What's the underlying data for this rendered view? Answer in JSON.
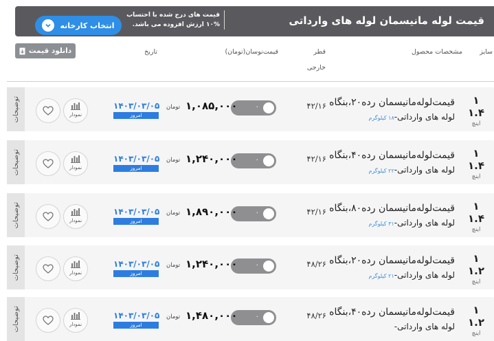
{
  "header": {
    "title": "قیمت لوله مانیسمان لوله های وارداتی",
    "note_line1": "قیمت های درج شده با احتساب",
    "note_line2": "۱۰% ارزش افزوده می باشد.",
    "factory_button": "انتخاب کارخانه"
  },
  "download_button": "دانلود قیمت",
  "columns": {
    "size": "سایز",
    "specs": "مشخصات محصول",
    "outer_dia_1": "قطر",
    "outer_dia_2": "خارجی",
    "price_change": "قیمت‌نوسان(تومان)",
    "date": "تاریخ"
  },
  "rows": [
    {
      "size": "۱ ۱.۴",
      "unit": "اینچ",
      "name": "قیمت‌لوله‌مانیسمان رده۲۰،بنگاه",
      "sub": "لوله های وارداتی-",
      "weight": "۱۸ کیلوگرم",
      "dia": "۴۲/۱۶",
      "toggle": "۰",
      "price": "۱,۰۸۵,۰۰۰",
      "toman": "تومان",
      "date": "۱۴۰۳/۰۳/۰۵",
      "today": "امروز",
      "chart_label": "نمودار",
      "desc": "توضیحات"
    },
    {
      "size": "۱ ۱.۴",
      "unit": "اینچ",
      "name": "قیمت‌لوله‌مانیسمان رده۴۰،بنگاه",
      "sub": "لوله های وارداتی-",
      "weight": "۲۲ کیلوگرم",
      "dia": "۴۲/۱۶",
      "toggle": "۰",
      "price": "۱,۲۴۰,۰۰۰",
      "toman": "تومان",
      "date": "۱۴۰۳/۰۳/۰۵",
      "today": "امروز",
      "chart_label": "نمودار",
      "desc": "توضیحات"
    },
    {
      "size": "۱ ۱.۴",
      "unit": "اینچ",
      "name": "قیمت‌لوله‌مانیسمان رده۸۰،بنگاه",
      "sub": "لوله های وارداتی-",
      "weight": "۳۱ کیلوگرم",
      "dia": "۴۲/۱۶",
      "toggle": "۰",
      "price": "۱,۸۹۰,۰۰۰",
      "toman": "تومان",
      "date": "۱۴۰۳/۰۳/۰۵",
      "today": "امروز",
      "chart_label": "نمودار",
      "desc": "توضیحات"
    },
    {
      "size": "۱ ۱.۲",
      "unit": "اینچ",
      "name": "قیمت‌لوله‌مانیسمان رده۲۰،بنگاه",
      "sub": "لوله های وارداتی-",
      "weight": "۲۱ کیلوگرم",
      "dia": "۴۸/۲۶",
      "toggle": "۰",
      "price": "۱,۲۴۰,۰۰۰",
      "toman": "تومان",
      "date": "۱۴۰۳/۰۳/۰۵",
      "today": "امروز",
      "chart_label": "نمودار",
      "desc": "توضیحات"
    },
    {
      "size": "۱ ۱.۲",
      "unit": "اینچ",
      "name": "قیمت‌لوله‌مانیسمان رده۴۰،بنگاه",
      "sub": "لوله های وارداتی-",
      "weight": "",
      "dia": "۴۸/۲۶",
      "toggle": "۰",
      "price": "۱,۴۸۰,۰۰۰",
      "toman": "تومان",
      "date": "۱۴۰۳/۰۳/۰۵",
      "today": "امروز",
      "chart_label": "نمودار",
      "desc": "توضیحات"
    }
  ]
}
